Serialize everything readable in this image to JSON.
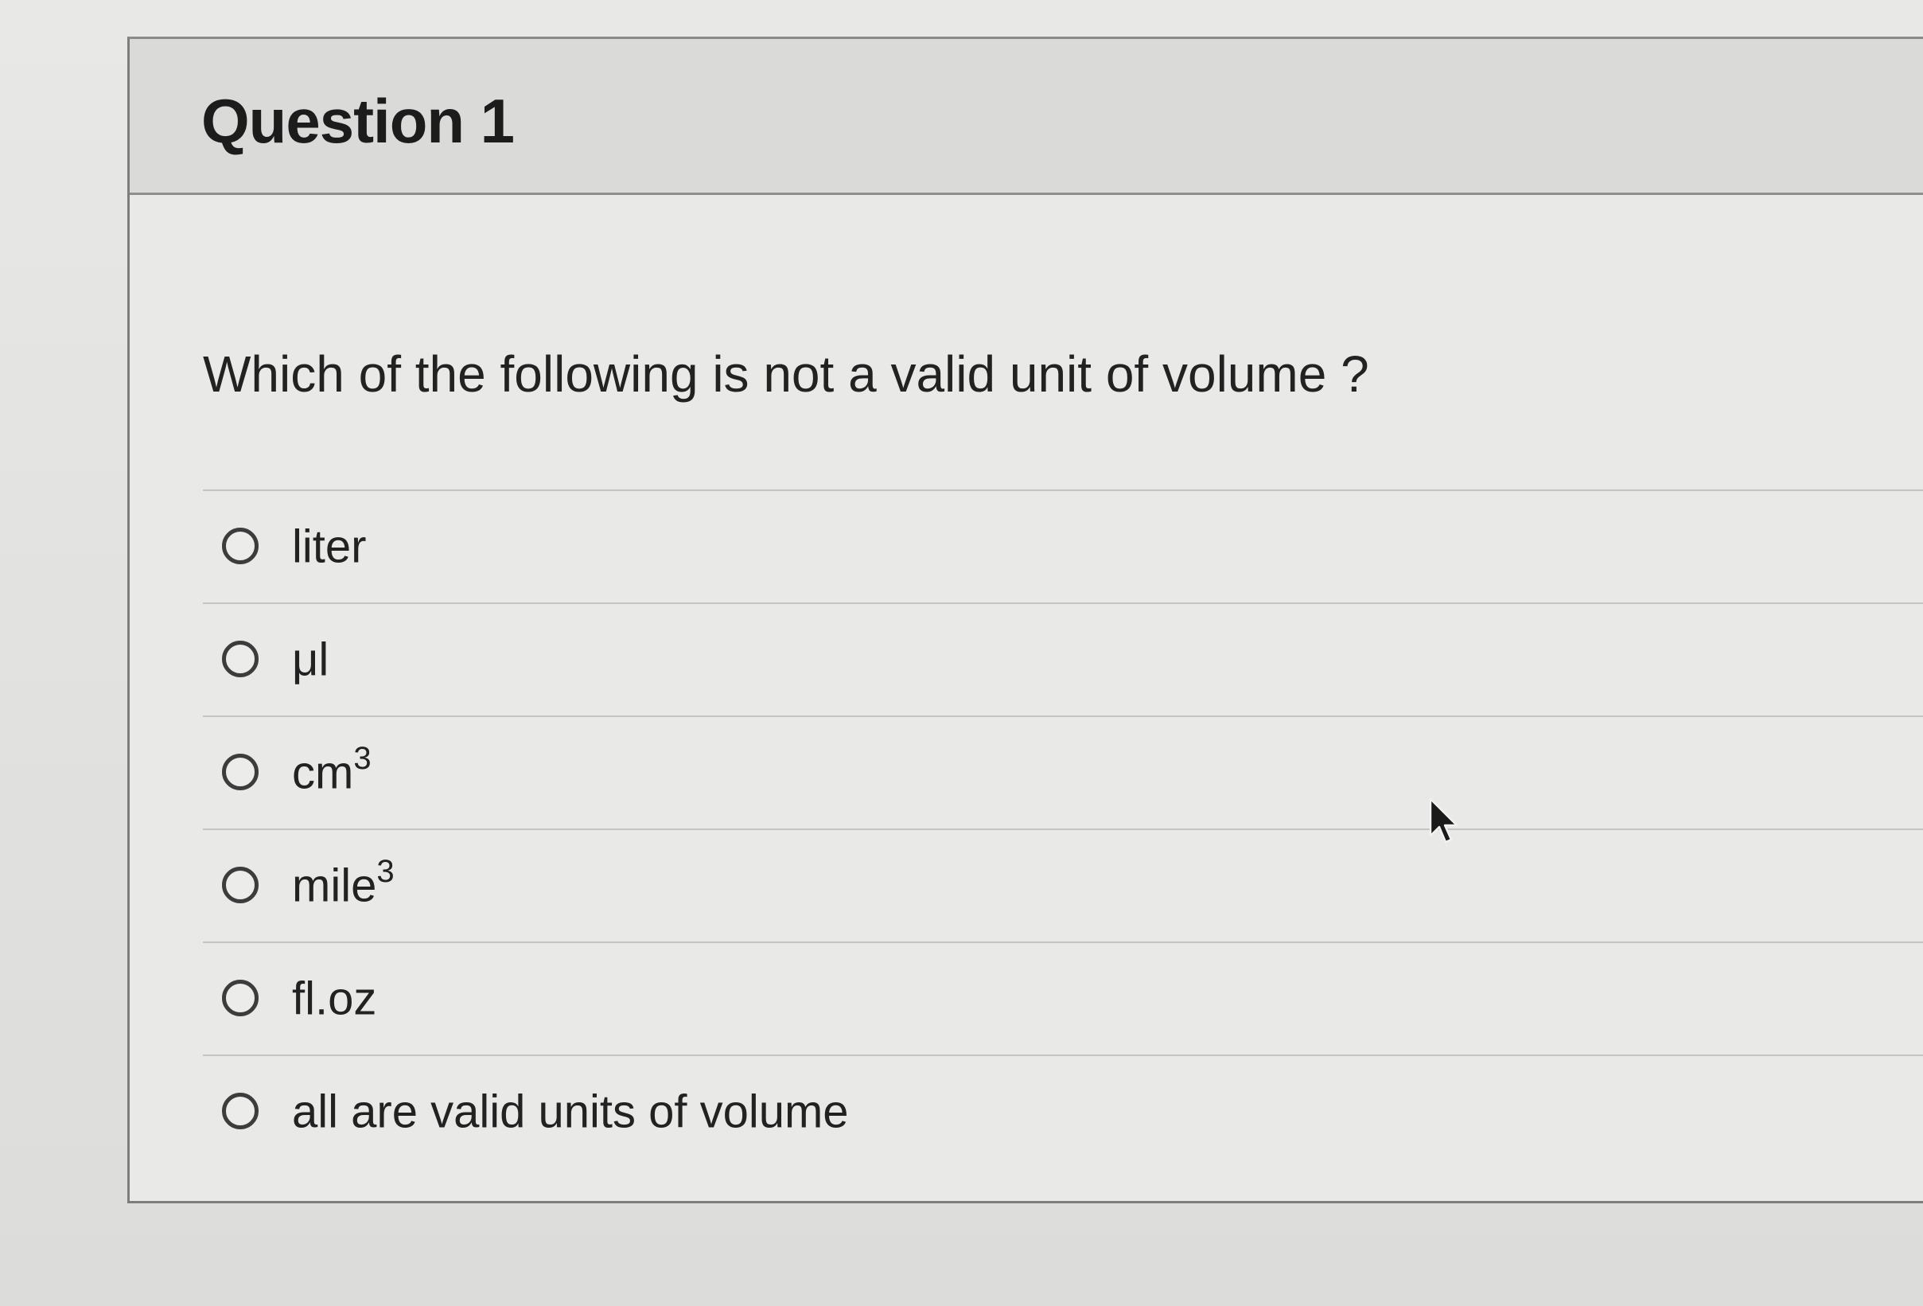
{
  "question": {
    "title": "Question 1",
    "text": "Which of the following is not a valid unit of volume ?"
  },
  "answers": [
    {
      "label": "liter",
      "sup": ""
    },
    {
      "label": "μl",
      "sup": ""
    },
    {
      "label": "cm",
      "sup": "3"
    },
    {
      "label": "mile",
      "sup": "3"
    },
    {
      "label": "fl.oz",
      "sup": ""
    },
    {
      "label": "all are valid units of volume",
      "sup": ""
    }
  ],
  "selected_answer": null,
  "icons": {
    "cursor": "mouse-pointer-icon",
    "radio": "radio-button-icon"
  },
  "colors": {
    "background": "#e4e4e2",
    "header": "#dadad8",
    "text": "#222222"
  }
}
